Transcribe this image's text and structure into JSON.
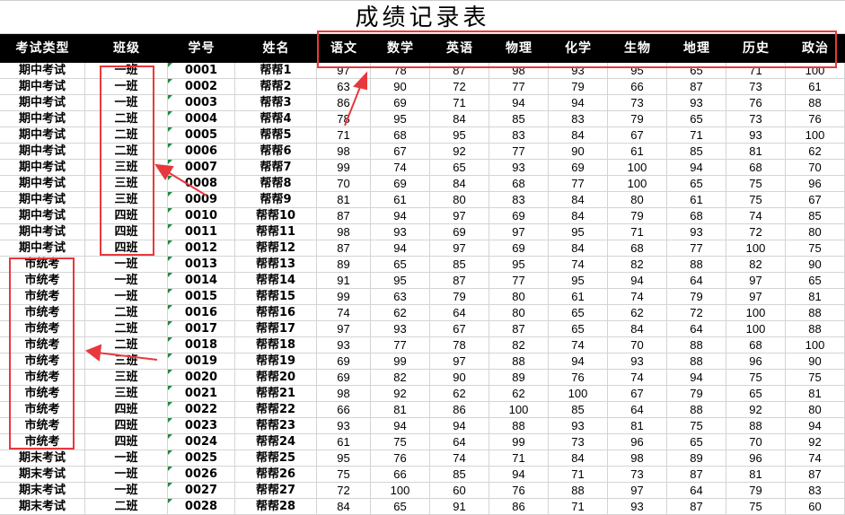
{
  "sheet": {
    "title": "成绩记录表"
  },
  "headers": [
    "考试类型",
    "班级",
    "学号",
    "姓名",
    "语文",
    "数学",
    "英语",
    "物理",
    "化学",
    "生物",
    "地理",
    "历史",
    "政治"
  ],
  "rows": [
    [
      "期中考试",
      "一班",
      "0001",
      "帮帮1",
      97,
      78,
      87,
      98,
      93,
      95,
      65,
      71,
      100
    ],
    [
      "期中考试",
      "一班",
      "0002",
      "帮帮2",
      63,
      90,
      72,
      77,
      79,
      66,
      87,
      73,
      61
    ],
    [
      "期中考试",
      "一班",
      "0003",
      "帮帮3",
      86,
      69,
      71,
      94,
      94,
      73,
      93,
      76,
      88
    ],
    [
      "期中考试",
      "二班",
      "0004",
      "帮帮4",
      78,
      95,
      84,
      85,
      83,
      79,
      65,
      73,
      76
    ],
    [
      "期中考试",
      "二班",
      "0005",
      "帮帮5",
      71,
      68,
      95,
      83,
      84,
      67,
      71,
      93,
      100
    ],
    [
      "期中考试",
      "二班",
      "0006",
      "帮帮6",
      98,
      67,
      92,
      77,
      90,
      61,
      85,
      81,
      62
    ],
    [
      "期中考试",
      "三班",
      "0007",
      "帮帮7",
      99,
      74,
      65,
      93,
      69,
      100,
      94,
      68,
      70
    ],
    [
      "期中考试",
      "三班",
      "0008",
      "帮帮8",
      70,
      69,
      84,
      68,
      77,
      100,
      65,
      75,
      96
    ],
    [
      "期中考试",
      "三班",
      "0009",
      "帮帮9",
      81,
      61,
      80,
      83,
      84,
      80,
      61,
      75,
      67
    ],
    [
      "期中考试",
      "四班",
      "0010",
      "帮帮10",
      87,
      94,
      97,
      69,
      84,
      79,
      68,
      74,
      85
    ],
    [
      "期中考试",
      "四班",
      "0011",
      "帮帮11",
      98,
      93,
      69,
      97,
      95,
      71,
      93,
      72,
      80
    ],
    [
      "期中考试",
      "四班",
      "0012",
      "帮帮12",
      87,
      94,
      97,
      69,
      84,
      68,
      77,
      100,
      75
    ],
    [
      "市统考",
      "一班",
      "0013",
      "帮帮13",
      89,
      65,
      85,
      95,
      74,
      82,
      88,
      82,
      90
    ],
    [
      "市统考",
      "一班",
      "0014",
      "帮帮14",
      91,
      95,
      87,
      77,
      95,
      94,
      64,
      97,
      65
    ],
    [
      "市统考",
      "一班",
      "0015",
      "帮帮15",
      99,
      63,
      79,
      80,
      61,
      74,
      79,
      97,
      81
    ],
    [
      "市统考",
      "二班",
      "0016",
      "帮帮16",
      74,
      62,
      64,
      80,
      65,
      62,
      72,
      100,
      88
    ],
    [
      "市统考",
      "二班",
      "0017",
      "帮帮17",
      97,
      93,
      67,
      87,
      65,
      84,
      64,
      100,
      88
    ],
    [
      "市统考",
      "二班",
      "0018",
      "帮帮18",
      93,
      77,
      78,
      82,
      74,
      70,
      88,
      68,
      100
    ],
    [
      "市统考",
      "三班",
      "0019",
      "帮帮19",
      69,
      99,
      97,
      88,
      94,
      93,
      88,
      96,
      90
    ],
    [
      "市统考",
      "三班",
      "0020",
      "帮帮20",
      69,
      82,
      90,
      89,
      76,
      74,
      94,
      75,
      75
    ],
    [
      "市统考",
      "三班",
      "0021",
      "帮帮21",
      98,
      92,
      62,
      62,
      100,
      67,
      79,
      65,
      81
    ],
    [
      "市统考",
      "四班",
      "0022",
      "帮帮22",
      66,
      81,
      86,
      100,
      85,
      64,
      88,
      92,
      80
    ],
    [
      "市统考",
      "四班",
      "0023",
      "帮帮23",
      93,
      94,
      94,
      88,
      93,
      81,
      75,
      88,
      94
    ],
    [
      "市统考",
      "四班",
      "0024",
      "帮帮24",
      61,
      75,
      64,
      99,
      73,
      96,
      65,
      70,
      92
    ],
    [
      "期末考试",
      "一班",
      "0025",
      "帮帮25",
      95,
      76,
      74,
      71,
      84,
      98,
      89,
      96,
      74
    ],
    [
      "期末考试",
      "一班",
      "0026",
      "帮帮26",
      75,
      66,
      85,
      94,
      71,
      73,
      87,
      81,
      87
    ],
    [
      "期末考试",
      "一班",
      "0027",
      "帮帮27",
      72,
      100,
      60,
      76,
      88,
      97,
      64,
      79,
      83
    ],
    [
      "期末考试",
      "二班",
      "0028",
      "帮帮28",
      84,
      65,
      91,
      86,
      71,
      93,
      87,
      75,
      60
    ]
  ],
  "colors": {
    "header_bg": "#000000",
    "header_text": "#ffffff",
    "annotation": "#e8383d",
    "grid": "#d4d4d4",
    "marker": "#1f8a3a"
  }
}
